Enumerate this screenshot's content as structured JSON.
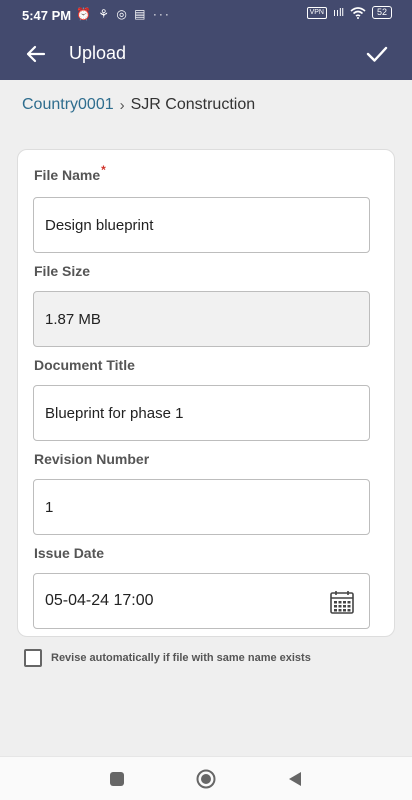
{
  "status_bar": {
    "time": "5:47 PM",
    "left_icons": "⏰ ⚘ ◎ ▤ ···",
    "vpn": "VPN",
    "signal": "ııll",
    "battery": "52"
  },
  "app_bar": {
    "title": "Upload"
  },
  "breadcrumb": {
    "parent": "Country0001",
    "separator": "›",
    "current": "SJR Construction"
  },
  "form": {
    "file_name": {
      "label": "File Name",
      "required_mark": "*",
      "value": "Design blueprint"
    },
    "file_size": {
      "label": "File Size",
      "value": "1.87 MB"
    },
    "document_title": {
      "label": "Document Title",
      "value": "Blueprint for phase 1"
    },
    "revision_number": {
      "label": "Revision Number",
      "value": "1"
    },
    "issue_date": {
      "label": "Issue Date",
      "value": "05-04-24 17:00"
    }
  },
  "revise_option": {
    "label": "Revise automatically if file with same name exists",
    "checked": false
  },
  "colors": {
    "app_bar": "#434a6e",
    "link": "#2e6d8e",
    "required": "#d0342c",
    "background": "#efefef"
  }
}
